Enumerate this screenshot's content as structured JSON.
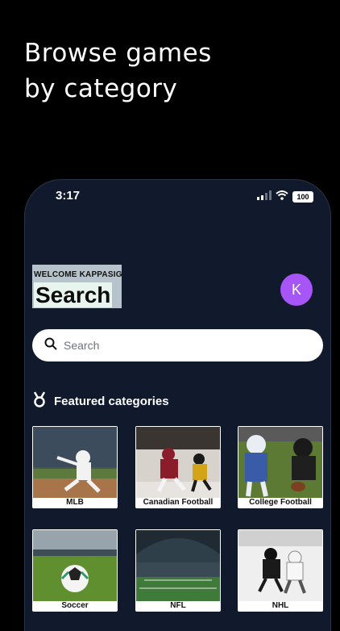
{
  "headline": {
    "line1": "Browse games",
    "line2": "by category"
  },
  "status_bar": {
    "time": "3:17",
    "battery": "100"
  },
  "header": {
    "welcome": "WELCOME KAPPASIG",
    "title": "Search",
    "avatar_initial": "K"
  },
  "search": {
    "placeholder": "Search"
  },
  "featured": {
    "title": "Featured categories",
    "items": [
      {
        "label": "MLB"
      },
      {
        "label": "Canadian Football"
      },
      {
        "label": "College Football"
      },
      {
        "label": "Soccer"
      },
      {
        "label": "NFL"
      },
      {
        "label": "NHL"
      }
    ]
  },
  "colors": {
    "phone_bg": "#111a2c",
    "avatar": "#a855f7",
    "page_bg": "#000000"
  }
}
